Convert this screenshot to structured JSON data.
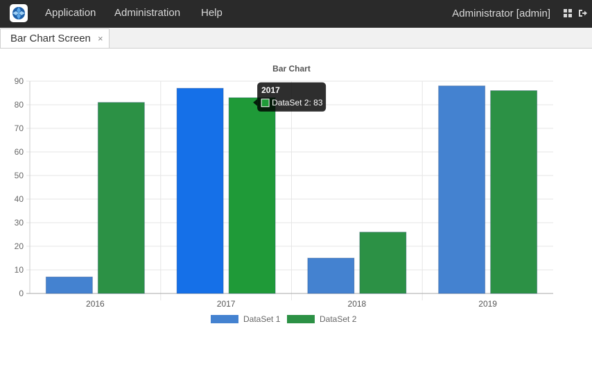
{
  "topbar": {
    "menu": [
      {
        "label": "Application"
      },
      {
        "label": "Administration"
      },
      {
        "label": "Help"
      }
    ],
    "user_label": "Administrator [admin]",
    "icons": [
      "app-logo-icon",
      "grid-icon",
      "logout-icon"
    ]
  },
  "tabs": [
    {
      "label": "Bar Chart Screen",
      "close": "×"
    }
  ],
  "chart_data": {
    "type": "bar",
    "title": "Bar Chart",
    "categories": [
      "2016",
      "2017",
      "2018",
      "2019"
    ],
    "series": [
      {
        "name": "DataSet 1",
        "values": [
          7,
          87,
          15,
          88
        ],
        "color": "#4482d0"
      },
      {
        "name": "DataSet 2",
        "values": [
          81,
          83,
          26,
          86
        ],
        "color": "#2c9145"
      }
    ],
    "ylim": [
      0,
      90
    ],
    "yticks": [
      0,
      10,
      20,
      30,
      40,
      50,
      60,
      70,
      80,
      90
    ],
    "grid": true,
    "legend": "bottom",
    "hover_colors": {
      "DataSet 1": "#1570e8",
      "DataSet 2": "#1f9a38"
    },
    "tooltip": {
      "title": "2017",
      "text": "DataSet 2: 83",
      "category": "2017",
      "series": "DataSet 2"
    }
  }
}
